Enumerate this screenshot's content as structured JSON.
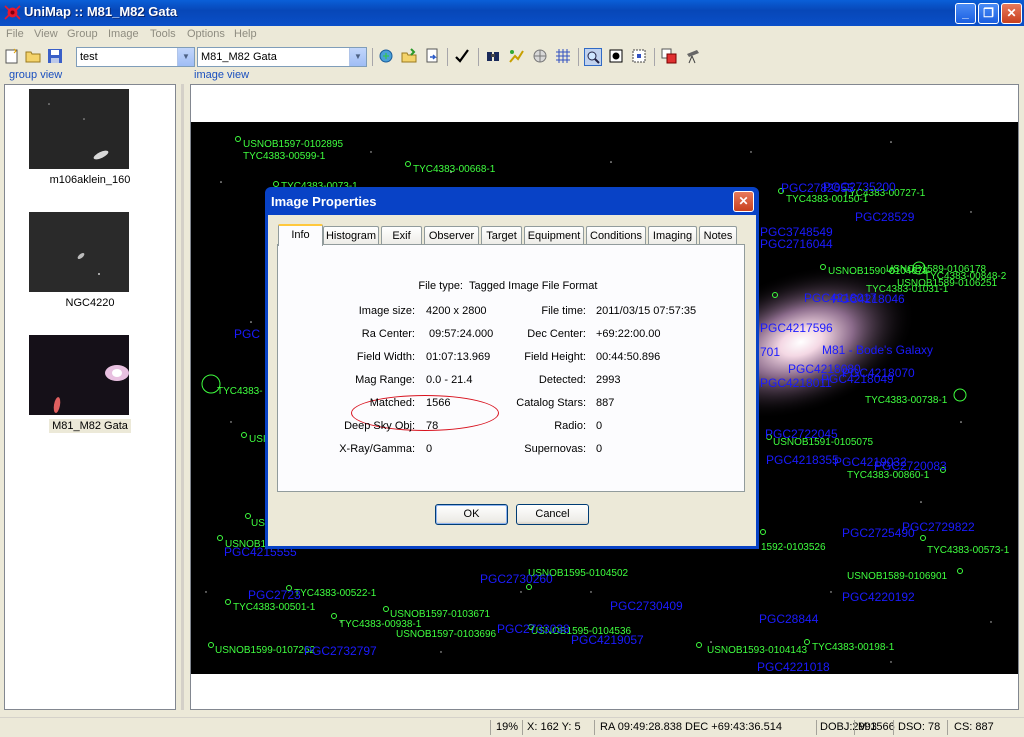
{
  "window": {
    "title": "UniMap :: M81_M82 Gata",
    "minimize": "_",
    "maximize": "❐",
    "close": "✕"
  },
  "menu": [
    "File",
    "View",
    "Group",
    "Image",
    "Tools",
    "Options",
    "Help"
  ],
  "toolbar": {
    "group_combo": "test",
    "image_combo": "M81_M82 Gata"
  },
  "panels": {
    "group_view": "group view",
    "image_view": "image view"
  },
  "thumbnails": [
    {
      "label": "m106aklein_160"
    },
    {
      "label": "NGC4220"
    },
    {
      "label": "M81_M82 Gata",
      "selected": true
    }
  ],
  "sky_labels": {
    "green": [
      "USNOB1597-0102895",
      "TYC4383-00599-1",
      "TYC4383-00668-1",
      "TYC4383-00727-1",
      "TYC4383-00150-1",
      "USNOB1590-0104678",
      "USNOB1589-0106178",
      "TYC4383-00848-2",
      "TYC4383-01031-1",
      "USNOB1589-0106251",
      "TYC4383-",
      "TYC4383-00738-1",
      "USNOB1591-0105075",
      "TYC4383-00860-1",
      "TYC4383-00573-1",
      "USNOB1589-0106901",
      "1592-0103526",
      "USNOB1595-0104502",
      "TYC4383-00522-1",
      "USNOB1597-0103671",
      "TYC4383-00938-1",
      "USNOB1597-0103696",
      "USNOB1595-0104536",
      "USNOB1593-0104143",
      "TYC4383-00198-1",
      "USNOB1599-0107262",
      "USI",
      "USI",
      "USNOB1",
      "TYC4383-00501-1",
      "TYC4383-0073-1"
    ],
    "blue": [
      "PGC2782055",
      "PGC28529",
      "PGC3748549",
      "PGC2716044",
      "PGC4217596",
      "701",
      "PGC4218080",
      "M81 - Bode's Galaxy",
      "PGC4218011",
      "PGC4218049",
      "PGC2722045",
      "PGC2720083",
      "PGC4219032",
      "PGC2725490",
      "PGC2729822",
      "PGC2730260",
      "PGC2730409",
      "PGC28844",
      "PGC4220192",
      "PGC2733038",
      "PGC4219057",
      "PGC4221018",
      "PGC2732797",
      "PGC2723",
      "PGC4218355",
      "PGC4218017",
      "PGC4218070",
      "PGC4215555",
      "PGC4218046",
      "PGC2735200",
      "PGC"
    ]
  },
  "dialog": {
    "title": "Image Properties",
    "close": "✕",
    "tabs": [
      "Info",
      "Histogram",
      "Exif",
      "Observer",
      "Target",
      "Equipment",
      "Conditions",
      "Imaging",
      "Notes"
    ],
    "file_type_label": "File type:",
    "file_type": "Tagged Image File Format",
    "left": [
      {
        "label": "Image size:",
        "value": "4200 x 2800"
      },
      {
        "label": "Ra Center:",
        "value": "09:57:24.000"
      },
      {
        "label": "Field Width:",
        "value": "01:07:13.969"
      },
      {
        "label": "Mag Range:",
        "value": "0.0 - 21.4"
      },
      {
        "label": "Matched:",
        "value": "1566"
      },
      {
        "label": "Deep Sky Obj:",
        "value": "78"
      },
      {
        "label": "X-Ray/Gamma:",
        "value": "0"
      }
    ],
    "right": [
      {
        "label": "File time:",
        "value": "2011/03/15 07:57:35"
      },
      {
        "label": "Dec Center:",
        "value": "+69:22:00.00"
      },
      {
        "label": "Field Height:",
        "value": "00:44:50.896"
      },
      {
        "label": "Detected:",
        "value": "2993"
      },
      {
        "label": "Catalog Stars:",
        "value": "887"
      },
      {
        "label": "Radio:",
        "value": "0"
      },
      {
        "label": "Supernovas:",
        "value": "0"
      }
    ],
    "ok": "OK",
    "cancel": "Cancel"
  },
  "status": {
    "zoom": "19%",
    "xy": "X: 162 Y:   5",
    "ra_dec": "RA  09:49:28.838 DEC +69:43:36.514",
    "dobj": "DOBJ:2993",
    "m": "M:1566",
    "dso": "DSO:  78",
    "cs": "CS: 887"
  },
  "colors": {
    "catalog_star": "#3fff3f",
    "galaxy_label": "#1b1bff",
    "highlight": "#d8121e"
  }
}
